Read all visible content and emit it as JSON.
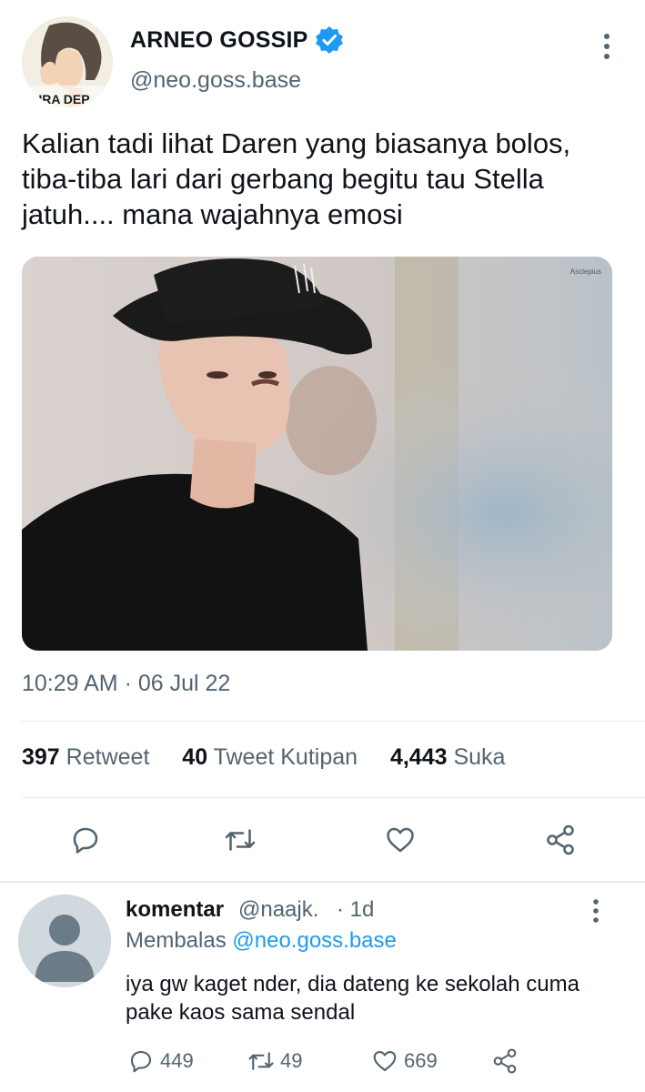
{
  "tweet": {
    "display_name": "ARNEO GOSSIP",
    "handle": "@neo.goss.base",
    "avatar_text": "HURA DEP",
    "text": "Kalian tadi lihat Daren yang biasanya bolos, tiba-tiba lari dari gerbang begitu tau Stella jatuh.... mana wajahnya emosi",
    "media_watermark": "Asclepius",
    "timestamp": "10:29 AM · 06 Jul 22",
    "stats": {
      "retweets": "397",
      "retweets_label": "Retweet",
      "quotes": "40",
      "quotes_label": "Tweet Kutipan",
      "likes": "4,443",
      "likes_label": "Suka"
    },
    "actions": [
      "reply-icon",
      "retweet-icon",
      "like-icon",
      "share-icon"
    ]
  },
  "reply": {
    "name": "komentar",
    "handle": "@naajk.",
    "time": "· 1d",
    "replying_label": "Membalas",
    "replying_to": "@neo.goss.base",
    "text": "iya gw kaget nder, dia dateng ke sekolah cuma pake kaos sama sendal",
    "replies": "449",
    "retweets": "49",
    "likes": "669"
  },
  "colors": {
    "text": "#0f1419",
    "secondary": "#536471",
    "accent": "#1d9bf0",
    "divider": "#e6ecf0"
  }
}
